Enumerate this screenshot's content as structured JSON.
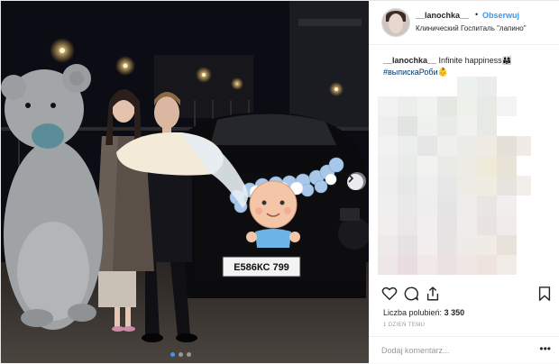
{
  "post": {
    "username": "__lanochka__",
    "separator": "•",
    "follow_label": "Obserwuj",
    "location": "Клинический Госпиталь \"лапино\"",
    "caption_user": "__lanochka__",
    "caption_text": " Infinite happiness",
    "caption_emoji": "👨‍👩‍👧",
    "hashtag": "#выпискаРоби",
    "hashtag_emoji": "👶",
    "likes_label": "Liczba polubień:",
    "likes_count": "3 350",
    "time_ago": "1 DZIEŃ TEMU",
    "comment_placeholder": "Dodaj komentarz...",
    "more_label": "•••",
    "license_plate": "Е586КС 799"
  },
  "icons": {
    "like": "heart-icon",
    "comment": "comment-bubble-icon",
    "share": "share-icon",
    "save": "bookmark-icon",
    "next": "chevron-right-icon"
  },
  "carousel": {
    "total": 3,
    "active": 1
  },
  "colors": {
    "link": "#3897f0",
    "hashtag": "#003569",
    "text": "#262626",
    "muted": "#999999"
  }
}
